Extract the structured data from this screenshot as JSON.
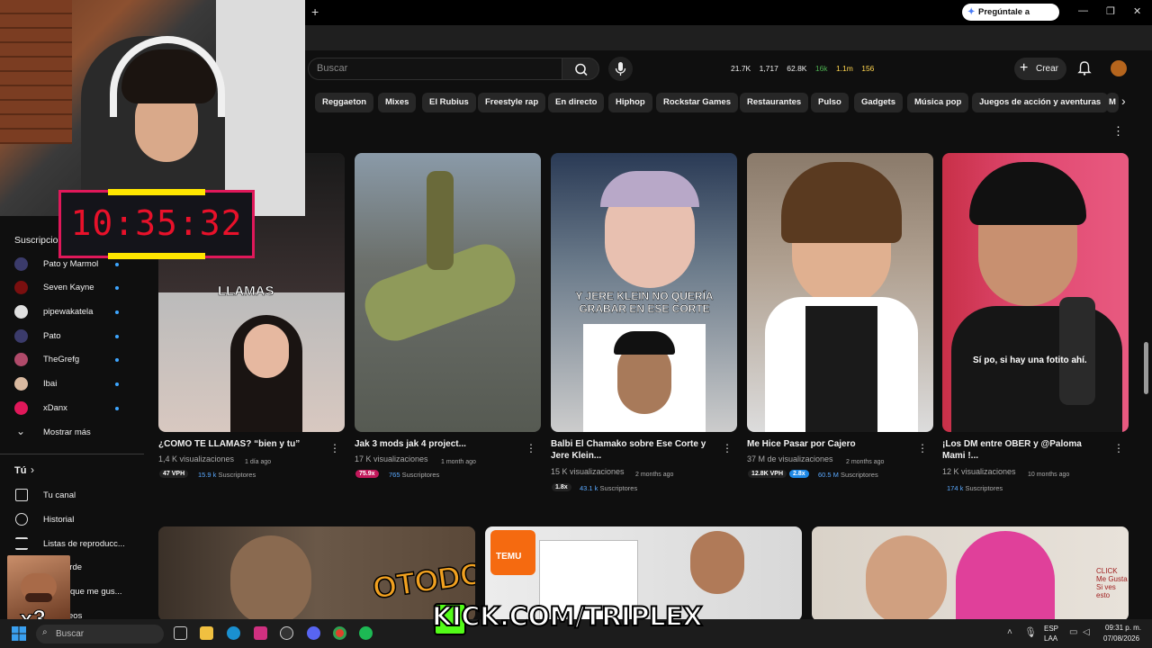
{
  "browser": {
    "new_tab": "+",
    "gemini_label": "Pregúntale a Gemini",
    "window_controls": [
      "—",
      "❐",
      "✕"
    ]
  },
  "youtube": {
    "search_placeholder": "Buscar",
    "stats": [
      "21.7K",
      "1,717",
      "62.8K",
      "16k",
      "1.1m",
      "156"
    ],
    "create_label": "Crear",
    "chips": [
      "Reggaeton",
      "Mixes",
      "El Rubius",
      "Freestyle rap",
      "En directo",
      "Hiphop",
      "Rockstar Games",
      "Restaurantes",
      "Pulso",
      "Gadgets",
      "Música pop",
      "Juegos de acción y aventuras",
      "M"
    ]
  },
  "sidebar": {
    "subs_header": "Suscripciones",
    "subscriptions": [
      {
        "name": "Pato y Marmol",
        "color": "#3b3b6b"
      },
      {
        "name": "Seven Kayne",
        "color": "#7a0f0f"
      },
      {
        "name": "pipewakatela",
        "color": "#e0e0e0"
      },
      {
        "name": "Pato",
        "color": "#3b3b6b"
      },
      {
        "name": "TheGrefg",
        "color": "#b04a6a"
      },
      {
        "name": "Ibai",
        "color": "#d9b9a0"
      },
      {
        "name": "xDanx",
        "color": "#e0185a"
      }
    ],
    "show_more": "Mostrar más",
    "you_header": "Tú",
    "you_items": [
      "Tu canal",
      "Historial",
      "Listas de reproducc...",
      "s tarde",
      "que me gus...",
      "eos"
    ]
  },
  "overlay": {
    "timer": "10:35:32",
    "kick_text": "KICK.COM/TRIPLEX",
    "multiplier": "x3"
  },
  "videos": [
    {
      "title": "¿COMO TE LLAMAS? “bien y tu”",
      "views": "1,4 K visualizaciones",
      "age": "1 día ago",
      "vph": "47 VPH",
      "subs": "15.9 k",
      "subs_label": "Suscriptores",
      "thumb_text": "LLAMAS"
    },
    {
      "title": "Jak 3 mods jak 4 project...",
      "views": "17 K visualizaciones",
      "age": "1 month ago",
      "vph": "75.9x",
      "subs": "765",
      "subs_label": "Suscriptores",
      "thumb_text": ""
    },
    {
      "title": "Balbi El Chamako sobre Ese Corte y Jere Klein...",
      "views": "15 K visualizaciones",
      "age": "2 months ago",
      "vph": "1.8x",
      "subs": "43.1 k",
      "subs_label": "Suscriptores",
      "thumb_text": "Y JERE KLEIN NO QUERÍA GRABAR EN ESE CORTE"
    },
    {
      "title": "Me Hice Pasar por Cajero",
      "views": "37 M de visualizaciones",
      "age": "2 months ago",
      "vph": "12.8K VPH",
      "vph2": "2.8x",
      "subs": "60.5 M",
      "subs_label": "Suscriptores",
      "thumb_text": ""
    },
    {
      "title": "¡Los DM entre OBER y @Paloma Mami !...",
      "views": "12 K visualizaciones",
      "age": "10 months ago",
      "vph": "",
      "subs": "174 k",
      "subs_label": "Suscriptores",
      "thumb_text": "Sí po, si hay una fotito ahí."
    }
  ],
  "row2": {
    "thumb_text_1": "OTODOS",
    "thumb_text_2": "TEMU",
    "thumb_text_3": "CLICK Me Gusta Si ves esto"
  },
  "taskbar": {
    "search": "Buscar",
    "lang": "ESP",
    "lang2": "LAA",
    "time": "09:31 p. m.",
    "date": "07/08/2026"
  }
}
